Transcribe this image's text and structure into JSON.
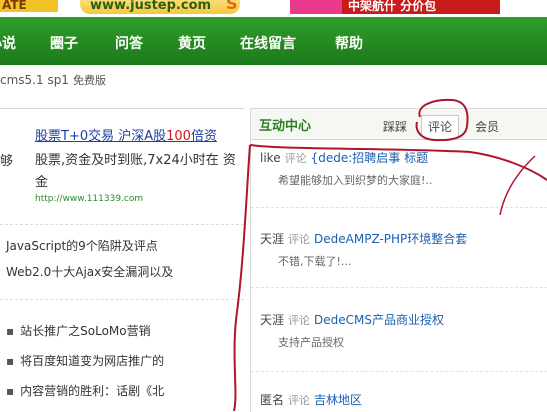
{
  "banner": {
    "left_ad_text": "ATE",
    "url_ad_text": "www.justep.com",
    "s_mark": "S",
    "right_ad_text": "中架航什 分价包"
  },
  "nav": {
    "items": [
      "小说",
      "圈子",
      "问答",
      "黄页",
      "在线留言",
      "帮助"
    ]
  },
  "version": {
    "label": "cms5.1 sp1",
    "free": "免费版"
  },
  "left": {
    "ad": {
      "title_part1": "股票T+0交易 沪深A股",
      "title_part2": "100",
      "title_part3": "倍资",
      "left_cut": "够",
      "desc": "股票,资金及时到账,7x24小时在 资金",
      "url": "http://www.111339.com"
    },
    "articles": [
      "JavaScript的9个陷阱及评点",
      "Web2.0十大Ajax安全漏洞以及"
    ],
    "bullets": [
      "站长推广之SoLoMo营销",
      "将百度知道变为网店推广的",
      "内容营销的胜利：话剧《北"
    ]
  },
  "right": {
    "panel_title": "互动中心",
    "tabs": [
      "踩踩",
      "评论",
      "会员"
    ],
    "active_tab": "评论",
    "comments": [
      {
        "user": "like",
        "action": "评论",
        "title": "{dede:招聘启事 标题",
        "body": "希望能够加入到织梦的大家庭!.."
      },
      {
        "user": "天涯",
        "action": "评论",
        "title": "DedeAMPZ-PHP环境整合套",
        "body": "不错,下载了!..."
      },
      {
        "user": "天涯",
        "action": "评论",
        "title": "DedeCMS产品商业授权",
        "body": "支持产品授权"
      },
      {
        "user": "匿名",
        "action": "评论",
        "title": "吉林地区",
        "body": ""
      }
    ]
  },
  "colors": {
    "nav_green": "#2a8f25",
    "marker_red": "#b0142a",
    "link_blue": "#1c5fb0"
  }
}
